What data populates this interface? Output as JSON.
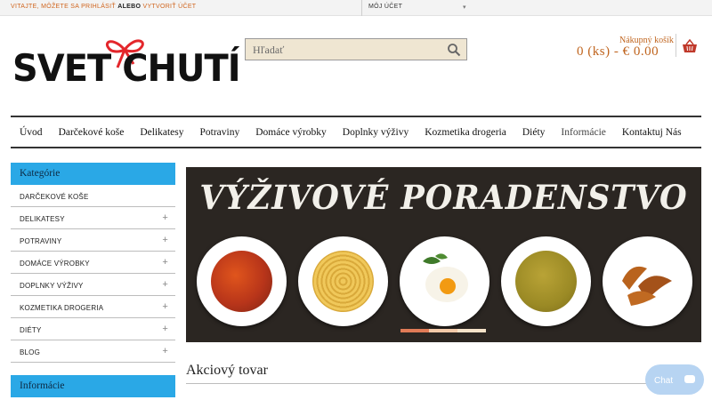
{
  "topbar": {
    "welcome": "VITAJTE, MÔŽETE SA PRIHLÁSIŤ",
    "or": "ALEBO",
    "register": "VYTVORIŤ ÚČET",
    "account": "MÔJ ÚČET"
  },
  "logo": {
    "text": "SVET CHUTÍ"
  },
  "search": {
    "placeholder": "Hľadať"
  },
  "cart": {
    "label": "Nákupný košík",
    "value": "0 (ks) - € 0.00"
  },
  "nav": [
    "Úvod",
    "Darčekové koše",
    "Delikatesy",
    "Potraviny",
    "Domáce výrobky",
    "Doplnky výživy",
    "Kozmetika drogeria",
    "Diéty",
    "Informácie",
    "Kontaktuj Nás"
  ],
  "sidebar": {
    "heading": "Kategórie",
    "items": [
      {
        "label": "DARČEKOVÉ KOŠE",
        "expandable": false
      },
      {
        "label": "DELIKATESY",
        "expandable": true
      },
      {
        "label": "POTRAVINY",
        "expandable": true
      },
      {
        "label": "DOMÁCE VÝROBKY",
        "expandable": true
      },
      {
        "label": "DOPLNKY VÝŽIVY",
        "expandable": true
      },
      {
        "label": "KOZMETIKA DROGERIA",
        "expandable": true
      },
      {
        "label": "DIÉTY",
        "expandable": true
      },
      {
        "label": "BLOG",
        "expandable": true
      }
    ],
    "plus_symbol": "+",
    "info_heading": "Informácie"
  },
  "banner": {
    "title": "VÝŽIVOVÉ PORADENSTVO"
  },
  "section": {
    "title": "Akciový tovar"
  },
  "chat": {
    "label": "Chat"
  },
  "colors": {
    "accent": "#c0651f",
    "sidebar_header": "#2aa8e6",
    "banner_bg": "#2b2622"
  }
}
